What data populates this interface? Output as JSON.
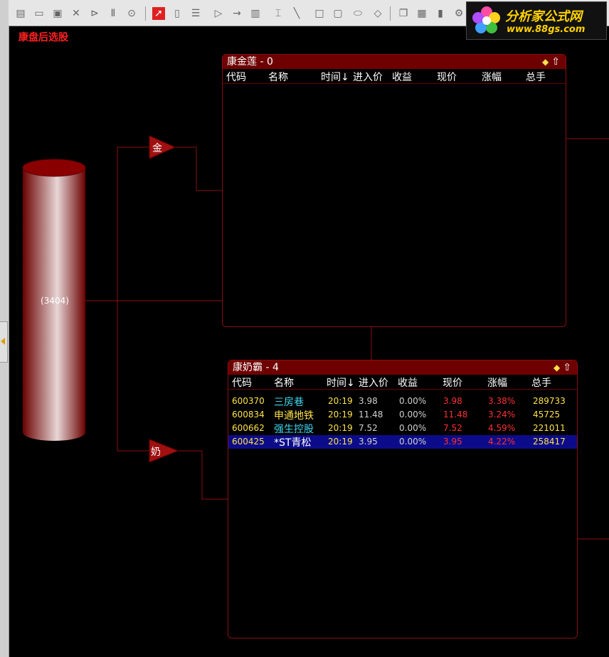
{
  "page_title": "康盘后选股",
  "logo": {
    "title": "分析家公式网",
    "url": "www.88gs.com"
  },
  "toolbar": {
    "buttons": [
      "new-icon",
      "open-icon",
      "save-icon",
      "delete-icon",
      "play-icon",
      "pause-icon",
      "stop-icon",
      "pointer-icon",
      "rounded-rect-icon",
      "list-icon",
      "triangle-icon",
      "arrow-icon",
      "group-icon",
      "text-icon",
      "line-icon",
      "rect-icon",
      "rounded-box-icon",
      "ellipse-icon",
      "diamond-icon",
      "copy-icon",
      "paste-icon",
      "trash-icon",
      "property-icon"
    ]
  },
  "source_node": {
    "label": "(3404)"
  },
  "filters": [
    {
      "label": "金"
    },
    {
      "label": "奶"
    }
  ],
  "panel_a": {
    "title": "康金莲 - 0",
    "icons": {
      "diamond": "◆",
      "up": "⇧"
    },
    "columns": [
      "代码",
      "名称",
      "时间↓",
      "进入价",
      "收益",
      "现价",
      "涨幅",
      "总手"
    ],
    "rows": []
  },
  "panel_b": {
    "title": "康奶霸 - 4",
    "icons": {
      "diamond": "◆",
      "up": "⇧"
    },
    "columns": [
      "代码",
      "名称",
      "时间↓",
      "进入价",
      "收益",
      "现价",
      "涨幅",
      "总手"
    ],
    "rows": [
      {
        "code": "600370",
        "name": "三房巷",
        "time": "20:19",
        "entry": "3.98",
        "ret": "0.00%",
        "price": "3.98",
        "chg": "3.38%",
        "vol": "289733",
        "name_color": "cyan"
      },
      {
        "code": "600834",
        "name": "申通地铁",
        "time": "20:19",
        "entry": "11.48",
        "ret": "0.00%",
        "price": "11.48",
        "chg": "3.24%",
        "vol": "45725",
        "name_color": "yellow"
      },
      {
        "code": "600662",
        "name": "强生控股",
        "time": "20:19",
        "entry": "7.52",
        "ret": "0.00%",
        "price": "7.52",
        "chg": "4.59%",
        "vol": "221011",
        "name_color": "cyan"
      },
      {
        "code": "600425",
        "name": "*ST青松",
        "time": "20:19",
        "entry": "3.95",
        "ret": "0.00%",
        "price": "3.95",
        "chg": "4.22%",
        "vol": "258417",
        "name_color": "white",
        "selected": true
      }
    ]
  }
}
